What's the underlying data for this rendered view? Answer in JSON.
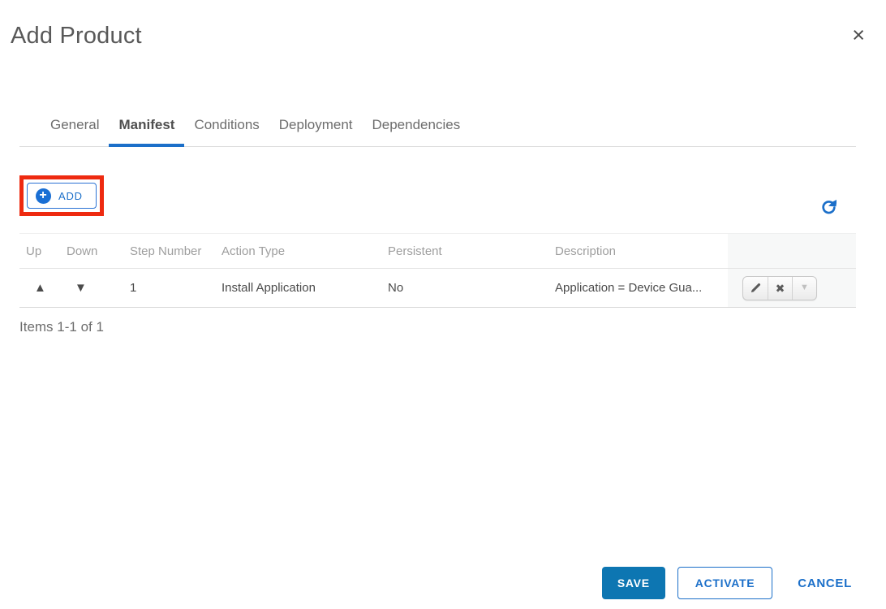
{
  "dialog": {
    "title": "Add Product",
    "close_glyph": "×"
  },
  "tabs": [
    {
      "label": "General",
      "active": false
    },
    {
      "label": "Manifest",
      "active": true
    },
    {
      "label": "Conditions",
      "active": false
    },
    {
      "label": "Deployment",
      "active": false
    },
    {
      "label": "Dependencies",
      "active": false
    }
  ],
  "toolbar": {
    "add_label": "ADD",
    "plus_glyph": "+"
  },
  "table": {
    "columns": [
      "Up",
      "Down",
      "Step Number",
      "Action Type",
      "Persistent",
      "Description"
    ],
    "rows": [
      {
        "up_glyph": "▲",
        "down_glyph": "▼",
        "step_number": "1",
        "action_type": "Install Application",
        "persistent": "No",
        "description": "Application = Device Gua...",
        "delete_glyph": "✖",
        "more_glyph": "▼"
      }
    ]
  },
  "pagination": {
    "items_text": "Items 1-1 of 1"
  },
  "footer": {
    "save_label": "SAVE",
    "activate_label": "ACTIVATE",
    "cancel_label": "CANCEL"
  },
  "colors": {
    "accent_blue": "#1b6fc9",
    "save_button_blue": "#0d76b2",
    "annotation_red": "#ee2a10",
    "title_gray": "#595959",
    "header_text_gray": "#9e9e9e",
    "cell_text_gray": "#4b4b4b"
  }
}
